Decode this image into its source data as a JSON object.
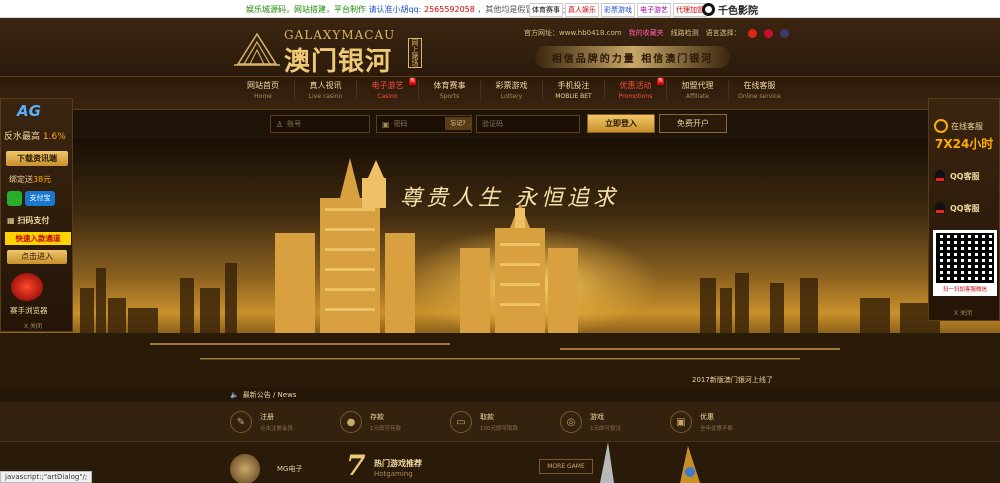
{
  "topstrip": {
    "promo_parts": [
      "娱乐城源码，网站搭建，平台制作",
      "请认准小胡qq:",
      "2565592058",
      "，其他均是假冒，请勿上当受骗！"
    ],
    "tags": [
      "体育赛事",
      "真人娱乐",
      "彩票游戏",
      "电子游艺",
      "代理加盟"
    ],
    "brand": "千色影院"
  },
  "header": {
    "logo_en": "GALAXYMACAU",
    "logo_cn": "澳门银河",
    "logo_stamp": "网上赌场",
    "site_label": "官方网址：www.hb0418.com",
    "links": [
      "我的收藏夹",
      "线路检测"
    ],
    "lang_label": "语言选择：",
    "slogan": "相信品牌的力量  相信澳门银河"
  },
  "nav": {
    "items": [
      {
        "cn": "网站首页",
        "en": "Home"
      },
      {
        "cn": "真人视讯",
        "en": "Live casino"
      },
      {
        "cn": "电子游艺",
        "en": "Casino"
      },
      {
        "cn": "体育赛事",
        "en": "Sports"
      },
      {
        "cn": "彩票游戏",
        "en": "Lottery"
      },
      {
        "cn": "手机投注",
        "en": "MOBLIE BET"
      },
      {
        "cn": "优惠活动",
        "en": "Promotions"
      },
      {
        "cn": "加盟代理",
        "en": "Affiliate"
      },
      {
        "cn": "在线客服",
        "en": "Online service"
      }
    ]
  },
  "login": {
    "username_placeholder": "账号",
    "password_placeholder": "密码",
    "forgot": "忘记?",
    "captcha_placeholder": "验证码",
    "login_button": "立即登入",
    "register_button": "免费开户"
  },
  "banner": {
    "headline": "尊贵人生  永恒追求",
    "ticker": "2017新版澳门银河上线了"
  },
  "news": {
    "label": "最新公告 / News"
  },
  "features": [
    {
      "title": "注册",
      "sub": "点击注册会员",
      "icon": "pen-icon",
      "glyph": "✎"
    },
    {
      "title": "存款",
      "sub": "1元即可存款",
      "icon": "piggy-bank-icon",
      "glyph": "●"
    },
    {
      "title": "取款",
      "sub": "100元即可取款",
      "icon": "card-icon",
      "glyph": "▭"
    },
    {
      "title": "游戏",
      "sub": "1元即可投注",
      "icon": "gamepad-icon",
      "glyph": "◎"
    },
    {
      "title": "优惠",
      "sub": "全年优惠不断",
      "icon": "gift-icon",
      "glyph": "▣"
    }
  ],
  "bottom": {
    "mg_label": "MG电子",
    "seven": "7",
    "hot_cn": "热门游戏推荐",
    "hot_en": "Hotgaming",
    "more": "MORE GAME"
  },
  "status": "javascript:;\"artDialog\"/;",
  "left_float": {
    "ag": "AG",
    "rebate": "反水最高",
    "rebate_pct": "1.6%",
    "download": "下载资讯端",
    "bind": "绑定送",
    "bind_amount": "38元",
    "alipay": "支付宝",
    "scan": "扫码支付",
    "fast": "快速入款通道",
    "enter": "点击进入",
    "browser": "赛手浏览器",
    "close": "X 关闭"
  },
  "right_float": {
    "online": "在线客服",
    "hours": "7X24小时",
    "qq1": "QQ客服",
    "qq2": "QQ客服",
    "qr_label": "扫一扫加客服微信",
    "close": "X 关闭"
  },
  "colors": {
    "gold": "#f0c978",
    "accent_red": "#ff4a3a",
    "dark_brown": "#2a1a0c"
  }
}
